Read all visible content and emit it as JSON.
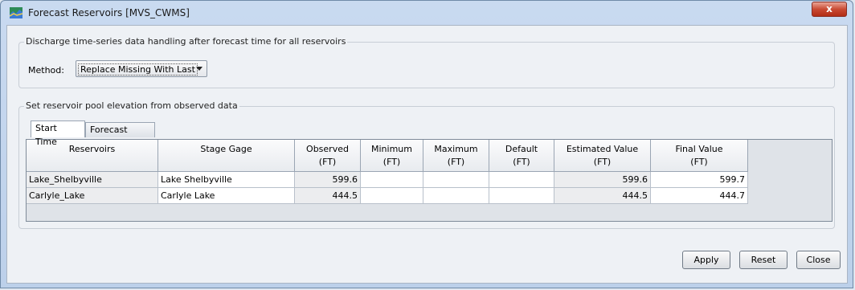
{
  "window": {
    "title": "Forecast Reservoirs [MVS_CWMS]",
    "close_glyph": "x"
  },
  "discharge_group": {
    "title": "Discharge time-series data handling after forecast time for all reservoirs",
    "method_label": "Method:",
    "method_value": "Replace Missing With Last"
  },
  "pool_group": {
    "title": "Set reservoir pool elevation from observed data",
    "tabs": [
      {
        "label": "Start Time"
      },
      {
        "label": "Forecast Time"
      }
    ]
  },
  "table": {
    "headers": [
      {
        "name": "Reservoirs",
        "unit": ""
      },
      {
        "name": "Stage Gage",
        "unit": ""
      },
      {
        "name": "Observed",
        "unit": "(FT)"
      },
      {
        "name": "Minimum",
        "unit": "(FT)"
      },
      {
        "name": "Maximum",
        "unit": "(FT)"
      },
      {
        "name": "Default",
        "unit": "(FT)"
      },
      {
        "name": "Estimated Value",
        "unit": "(FT)"
      },
      {
        "name": "Final Value",
        "unit": "(FT)"
      }
    ],
    "rows": [
      {
        "reservoir": "Lake_Shelbyville",
        "stage_gage": "Lake Shelbyville",
        "observed": "599.6",
        "minimum": "",
        "maximum": "",
        "default": "",
        "estimated": "599.6",
        "final": "599.7"
      },
      {
        "reservoir": "Carlyle_Lake",
        "stage_gage": "Carlyle Lake",
        "observed": "444.5",
        "minimum": "",
        "maximum": "",
        "default": "",
        "estimated": "444.5",
        "final": "444.7"
      }
    ]
  },
  "buttons": {
    "apply": "Apply",
    "reset": "Reset",
    "close": "Close"
  }
}
